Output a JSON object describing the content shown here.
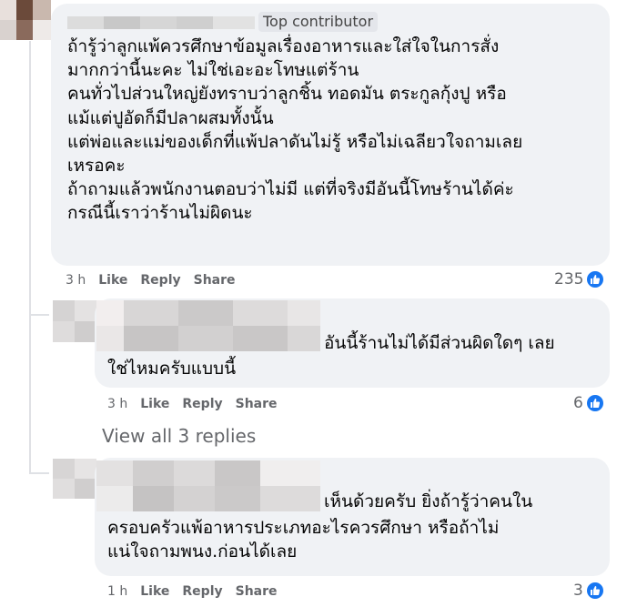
{
  "comments": [
    {
      "badge": "Top contributor",
      "lines": [
        "ถ้ารู้ว่าลูกแพ้ควรศึกษาข้อมูลเรื่องอาหารและใส่ใจในการสั่ง",
        "มากกว่านี้นะคะ ไม่ใช่เอะอะโทษแต่ร้าน",
        "คนทั่วไปส่วนใหญ่ยังทราบว่าลูกชิ้น ทอดมัน ตระกูลกุ้งปู หรือ",
        "แม้แต่ปูอัดก็มีปลาผสมทั้งนั้น",
        "แต่พ่อและแม่ของเด็กที่แพ้ปลาดันไม่รู้ หรือไม่เฉลียวใจถามเลย",
        "เหรอคะ",
        "ถ้าถามแล้วพนักงานตอบว่าไม่มี แต่ที่จริงมีอันนี้โทษร้านได้ค่ะ",
        "กรณีนี้เราว่าร้านไม่ผิดนะ"
      ],
      "time": "3 h",
      "like": "Like",
      "reply": "Reply",
      "share": "Share",
      "reactions": "235"
    },
    {
      "lines": [
        "อันนี้ร้านไม่ได้มีส่วนผิดใดๆ เลย",
        "ใช่ไหมครับแบบนี้"
      ],
      "time": "3 h",
      "like": "Like",
      "reply": "Reply",
      "share": "Share",
      "reactions": "6"
    },
    {
      "lines": [
        "เห็นด้วยครับ ยิ่งถ้ารู้ว่าคนใน",
        "ครอบครัวแพ้อาหารประเภทอะไรควรศึกษา หรือถ้าไม่",
        "แน่ใจถามพนง.ก่อนได้เลย"
      ],
      "time": "1 h",
      "like": "Like",
      "reply": "Reply",
      "share": "Share",
      "reactions": "3"
    }
  ],
  "view_replies": "View all 3 replies",
  "colors": {
    "bubble": "#f0f2f5",
    "like_blue": "#1877f2",
    "meta_gray": "#65676b"
  },
  "icons": {
    "reaction": "like-thumb-icon"
  }
}
